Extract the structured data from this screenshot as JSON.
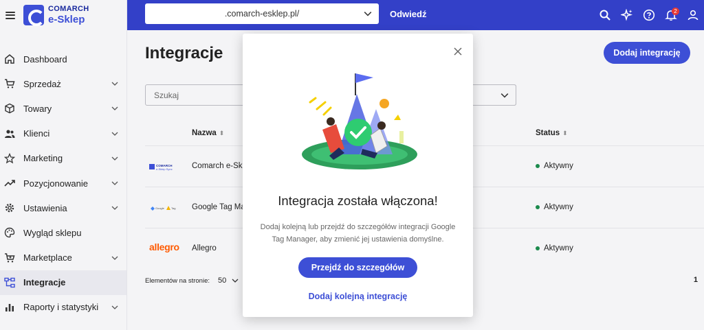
{
  "brand": {
    "line1": "COMARCH",
    "line2": "e-Sklep"
  },
  "sidebar": {
    "items": [
      {
        "label": "Dashboard",
        "icon": "home-icon",
        "expandable": false,
        "active": false
      },
      {
        "label": "Sprzedaż",
        "icon": "cart-icon",
        "expandable": true,
        "active": false
      },
      {
        "label": "Towary",
        "icon": "box-icon",
        "expandable": true,
        "active": false
      },
      {
        "label": "Klienci",
        "icon": "users-icon",
        "expandable": true,
        "active": false
      },
      {
        "label": "Marketing",
        "icon": "star-icon",
        "expandable": true,
        "active": false
      },
      {
        "label": "Pozycjonowanie",
        "icon": "trend-icon",
        "expandable": true,
        "active": false
      },
      {
        "label": "Ustawienia",
        "icon": "gear-icon",
        "expandable": true,
        "active": false
      },
      {
        "label": "Wygląd sklepu",
        "icon": "palette-icon",
        "expandable": false,
        "active": false
      },
      {
        "label": "Marketplace",
        "icon": "cart-plus-icon",
        "expandable": true,
        "active": false
      },
      {
        "label": "Integracje",
        "icon": "integration-icon",
        "expandable": false,
        "active": true
      },
      {
        "label": "Raporty i statystyki",
        "icon": "chart-icon",
        "expandable": true,
        "active": false
      }
    ]
  },
  "topbar": {
    "store_url": ".comarch-esklep.pl/",
    "visit_label": "Odwiedź",
    "notification_count": "2"
  },
  "main": {
    "title": "Integracje",
    "add_button": "Dodaj integrację",
    "search_placeholder": "Szukaj",
    "columns": {
      "name": "Nazwa",
      "status": "Status"
    },
    "rows": [
      {
        "logo_text": "COMARCH e-Sklep Sync",
        "name": "Comarch e-Sklep",
        "status": "Aktywny"
      },
      {
        "logo_text": "Google Tag Manager",
        "name": "Google Tag Manager",
        "status": "Aktywny"
      },
      {
        "logo_text": "allegro",
        "name": "Allegro",
        "status": "Aktywny"
      }
    ],
    "pager_label": "Elementów na stronie:",
    "pager_value": "50",
    "page_number": "1"
  },
  "modal": {
    "title": "Integracja została włączona!",
    "description": "Dodaj kolejną lub przejdź do szczegółów integracji Google Tag Manager, aby zmienić jej ustawienia domyślne.",
    "primary_button": "Przejdź do szczegółów",
    "secondary_link": "Dodaj kolejną integrację"
  },
  "colors": {
    "primary": "#3d4fd6",
    "topbar": "#3340c8",
    "active_status": "#1b8a4c",
    "allegro": "#ff5a00"
  }
}
